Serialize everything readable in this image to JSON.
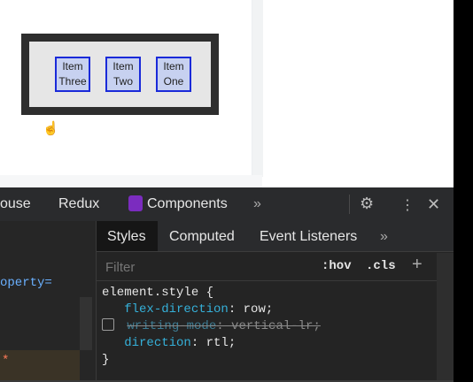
{
  "demo": {
    "items": [
      "Item One",
      "Item Two",
      "Item Three"
    ]
  },
  "devtools": {
    "top_tabs": {
      "lighthouse": "ouse",
      "redux": "Redux",
      "components": "Components",
      "more": "»"
    },
    "icons": {
      "gear": "⚙",
      "menu": "⋮",
      "close": "✕"
    },
    "left_pane": {
      "text": "operty=",
      "star": "*"
    },
    "sub_tabs": {
      "styles": "Styles",
      "computed": "Computed",
      "event_listeners": "Event Listeners",
      "more": "»"
    },
    "filter": {
      "placeholder": "Filter",
      "hov": ":hov",
      "cls": ".cls",
      "plus": "+"
    },
    "rules": {
      "selector": "element.style {",
      "declarations": [
        {
          "prop": "flex-direction",
          "value": "row;",
          "struck": false
        },
        {
          "prop": "writing-mode",
          "value": "vertical-lr;",
          "struck": true
        },
        {
          "prop": "direction",
          "value": "rtl;",
          "struck": false
        }
      ],
      "close": "}"
    }
  }
}
